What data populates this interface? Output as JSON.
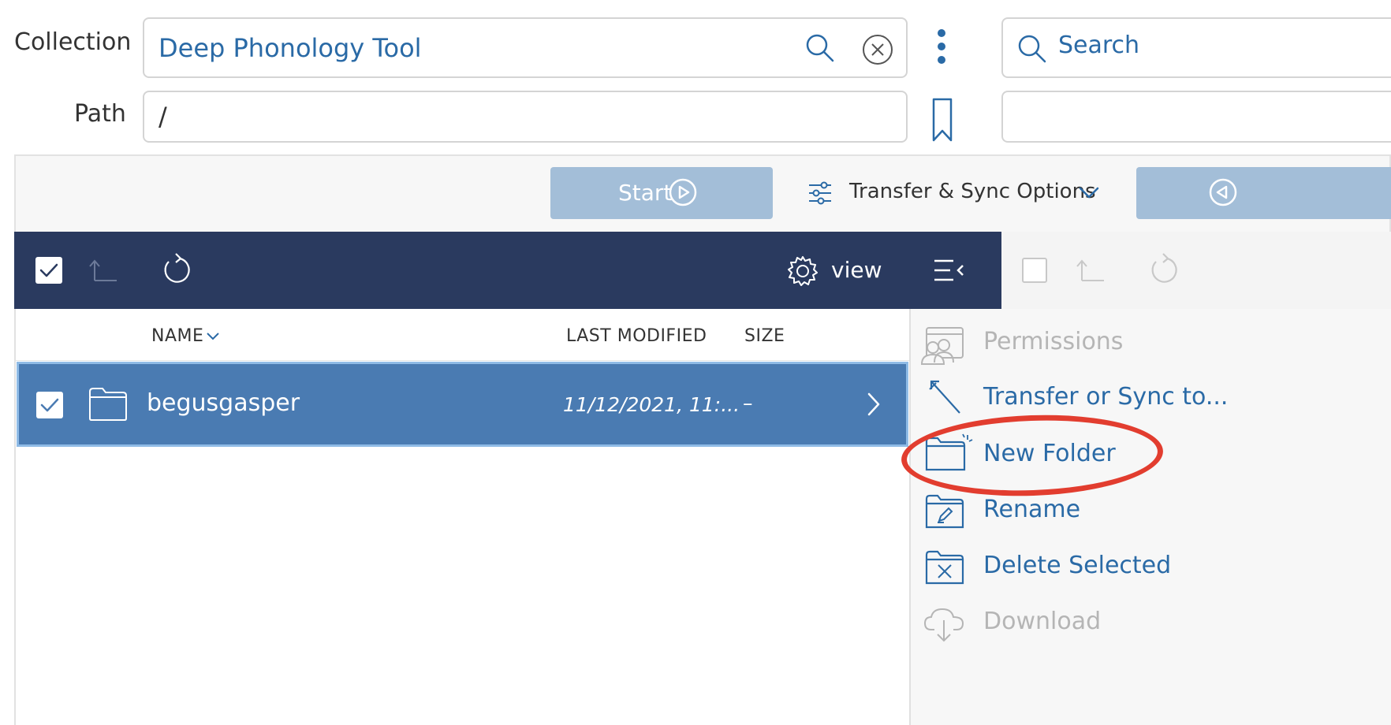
{
  "form": {
    "collection_label": "Collection",
    "collection_value": "Deep Phonology Tool",
    "path_label": "Path",
    "path_value": "/",
    "right_search_label": "Search",
    "right_path_value": ""
  },
  "toolbar": {
    "start_label": "Start",
    "options_label": "Transfer & Sync Options"
  },
  "navbar": {
    "view_label": "view"
  },
  "table": {
    "columns": [
      "NAME",
      "LAST MODIFIED",
      "SIZE"
    ],
    "rows": [
      {
        "name": "begusgasper",
        "modified": "11/12/2021, 11:...",
        "size": "–"
      }
    ]
  },
  "menu": {
    "items": [
      {
        "label": "Permissions",
        "icon": "permissions-icon",
        "enabled": false
      },
      {
        "label": "Transfer or Sync to...",
        "icon": "transfer-icon",
        "enabled": true
      },
      {
        "label": "New Folder",
        "icon": "new-folder-icon",
        "enabled": true,
        "highlighted": true
      },
      {
        "label": "Rename",
        "icon": "rename-icon",
        "enabled": true
      },
      {
        "label": "Delete Selected",
        "icon": "delete-folder-icon",
        "enabled": true
      },
      {
        "label": "Download",
        "icon": "download-cloud-icon",
        "enabled": false
      }
    ]
  },
  "colors": {
    "accent": "#2a6aa6",
    "navbar": "#2a3a5f",
    "selected_row": "#4a7bb2",
    "start_button": "#a3bed8",
    "highlight_ring": "#e23d2f",
    "disabled_text": "#b5b5b5"
  }
}
